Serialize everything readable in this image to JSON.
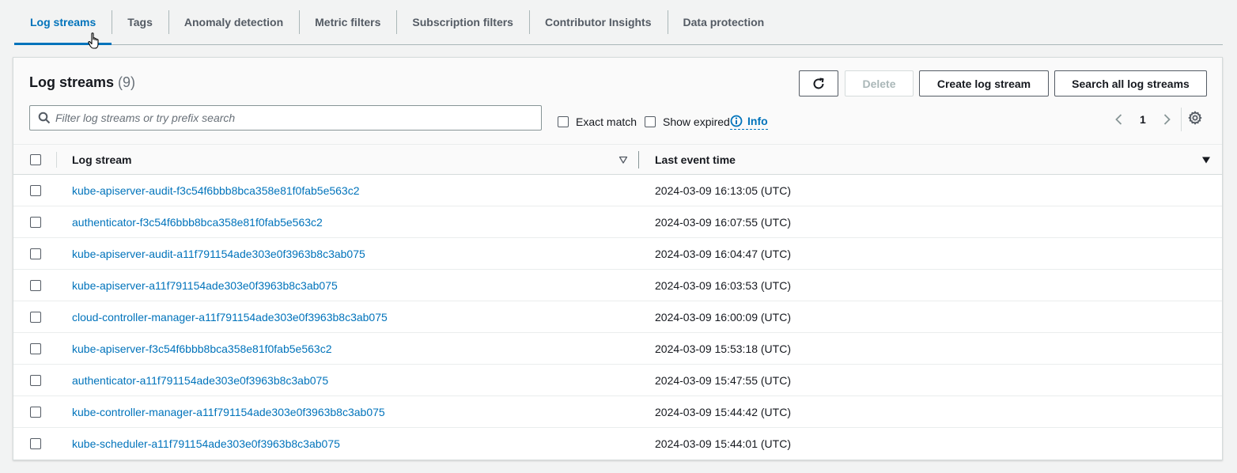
{
  "tabs": [
    {
      "label": "Log streams",
      "active": true
    },
    {
      "label": "Tags"
    },
    {
      "label": "Anomaly detection"
    },
    {
      "label": "Metric filters"
    },
    {
      "label": "Subscription filters"
    },
    {
      "label": "Contributor Insights"
    },
    {
      "label": "Data protection"
    }
  ],
  "panel": {
    "title": "Log streams",
    "count": "(9)",
    "buttons": {
      "refresh_icon": "refresh-icon",
      "delete": "Delete",
      "create": "Create log stream",
      "search_all": "Search all log streams"
    },
    "filter": {
      "placeholder": "Filter log streams or try prefix search",
      "value": ""
    },
    "options": {
      "exact_match": "Exact match",
      "show_expired": "Show expired",
      "info": "Info"
    },
    "pagination": {
      "page": "1"
    }
  },
  "table": {
    "headers": {
      "stream": "Log stream",
      "time": "Last event time"
    },
    "rows": [
      {
        "stream": "kube-apiserver-audit-f3c54f6bbb8bca358e81f0fab5e563c2",
        "time": "2024-03-09 16:13:05 (UTC)"
      },
      {
        "stream": "authenticator-f3c54f6bbb8bca358e81f0fab5e563c2",
        "time": "2024-03-09 16:07:55 (UTC)"
      },
      {
        "stream": "kube-apiserver-audit-a11f791154ade303e0f3963b8c3ab075",
        "time": "2024-03-09 16:04:47 (UTC)"
      },
      {
        "stream": "kube-apiserver-a11f791154ade303e0f3963b8c3ab075",
        "time": "2024-03-09 16:03:53 (UTC)"
      },
      {
        "stream": "cloud-controller-manager-a11f791154ade303e0f3963b8c3ab075",
        "time": "2024-03-09 16:00:09 (UTC)"
      },
      {
        "stream": "kube-apiserver-f3c54f6bbb8bca358e81f0fab5e563c2",
        "time": "2024-03-09 15:53:18 (UTC)"
      },
      {
        "stream": "authenticator-a11f791154ade303e0f3963b8c3ab075",
        "time": "2024-03-09 15:47:55 (UTC)"
      },
      {
        "stream": "kube-controller-manager-a11f791154ade303e0f3963b8c3ab075",
        "time": "2024-03-09 15:44:42 (UTC)"
      },
      {
        "stream": "kube-scheduler-a11f791154ade303e0f3963b8c3ab075",
        "time": "2024-03-09 15:44:01 (UTC)"
      }
    ]
  },
  "colors": {
    "accent": "#0073bb",
    "text": "#16191f",
    "muted": "#687078",
    "background": "#f2f3f3"
  }
}
